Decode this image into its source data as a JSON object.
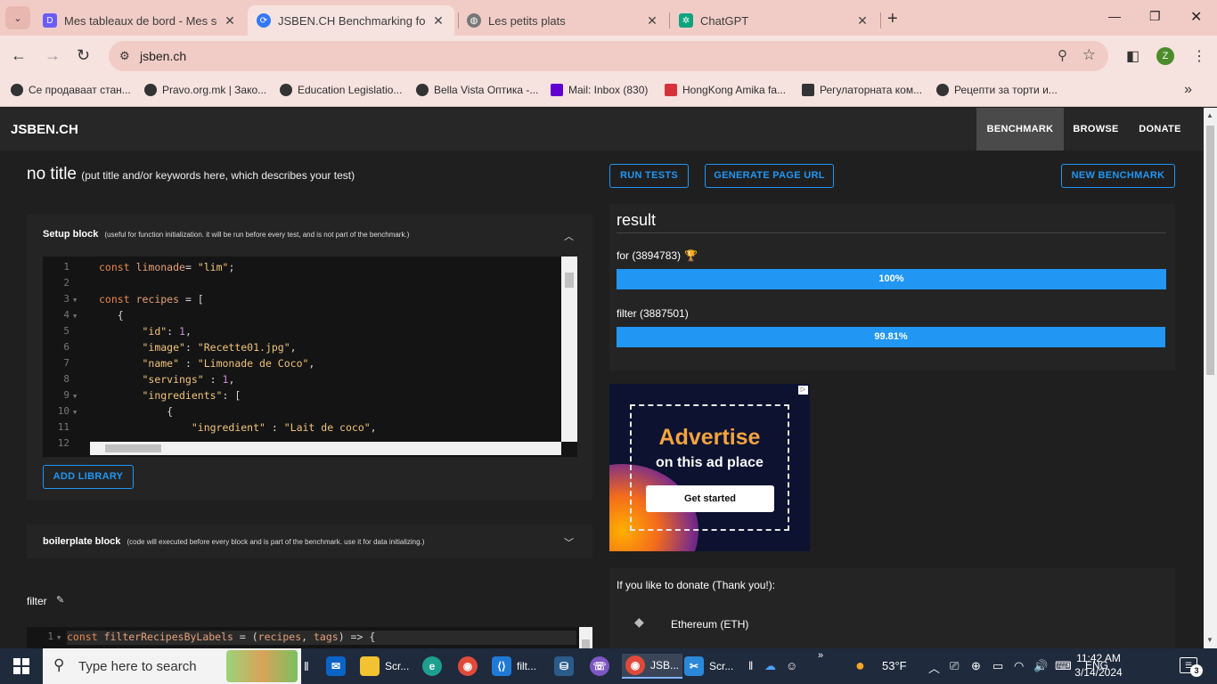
{
  "browser": {
    "tabs": [
      {
        "title": "Mes tableaux de bord - Mes se",
        "favicon_color": "#6a5cff",
        "active": false
      },
      {
        "title": "JSBEN.CH Benchmarking for Jav",
        "favicon_color": "#3478f6",
        "active": true
      },
      {
        "title": "Les petits plats",
        "favicon_color": "#777777",
        "active": false
      },
      {
        "title": "ChatGPT",
        "favicon_color": "#10a37f",
        "active": false
      }
    ],
    "close_glyph": "✕",
    "new_tab_glyph": "+",
    "url": "jsben.ch",
    "profile_initial": "Z",
    "bookmarks": [
      {
        "label": "Се продаваат стан...",
        "color": "#333333"
      },
      {
        "label": "Pravo.org.mk | Зако...",
        "color": "#333333"
      },
      {
        "label": "Education Legislatio...",
        "color": "#333333"
      },
      {
        "label": "Bella Vista Оптика -...",
        "color": "#333333"
      },
      {
        "label": "Mail: Inbox (830)",
        "color": "#6001d2"
      },
      {
        "label": "HongKong Amika fa...",
        "color": "#d6323a"
      },
      {
        "label": "Регулаторната ком...",
        "color": "#333333"
      },
      {
        "label": "Рецепти за торти и...",
        "color": "#333333"
      }
    ]
  },
  "app": {
    "brand": "JSBEN.CH",
    "nav": [
      "BENCHMARK",
      "BROWSE",
      "DONATE"
    ],
    "title": "no title",
    "title_hint": "(put title and/or keywords here, which describes your test)",
    "buttons": {
      "run": "RUN TESTS",
      "generate": "GENERATE PAGE URL",
      "new": "NEW BENCHMARK",
      "add_library": "ADD LIBRARY"
    },
    "setup_block": {
      "label": "Setup block",
      "hint": "(useful for function initialization. it will be run before every test, and is not part of the benchmark.)",
      "line_numbers": [
        "1",
        "2",
        "3",
        "4",
        "5",
        "6",
        "7",
        "8",
        "9",
        "10",
        "11",
        "12"
      ]
    },
    "boilerplate_block": {
      "label": "boilerplate block",
      "hint": "(code will executed before every block and is part of the benchmark. use it for data initializing.)"
    },
    "filter_block": {
      "label": "filter",
      "line_numbers": [
        "1"
      ]
    },
    "result": {
      "title": "result",
      "items": [
        {
          "label": "for (3894783)",
          "bar": "100%",
          "fraction": 1.0,
          "winner": true
        },
        {
          "label": "filter (3887501)",
          "bar": "99.81%",
          "fraction": 0.9981,
          "winner": false
        }
      ]
    },
    "ad": {
      "headline": "Advertise",
      "subline": "on this ad place",
      "cta": "Get started"
    },
    "donate": {
      "title": "If you like to donate (Thank you!):",
      "coin": "Ethereum (ETH)"
    }
  },
  "taskbar": {
    "search_placeholder": "Type here to search",
    "apps": [
      "Scr...",
      "filt...",
      "JSB...",
      "Scr..."
    ],
    "weather": "53°F",
    "lang": "ENG",
    "time": "11:42 AM",
    "date": "3/14/2024",
    "notifications": "3"
  }
}
